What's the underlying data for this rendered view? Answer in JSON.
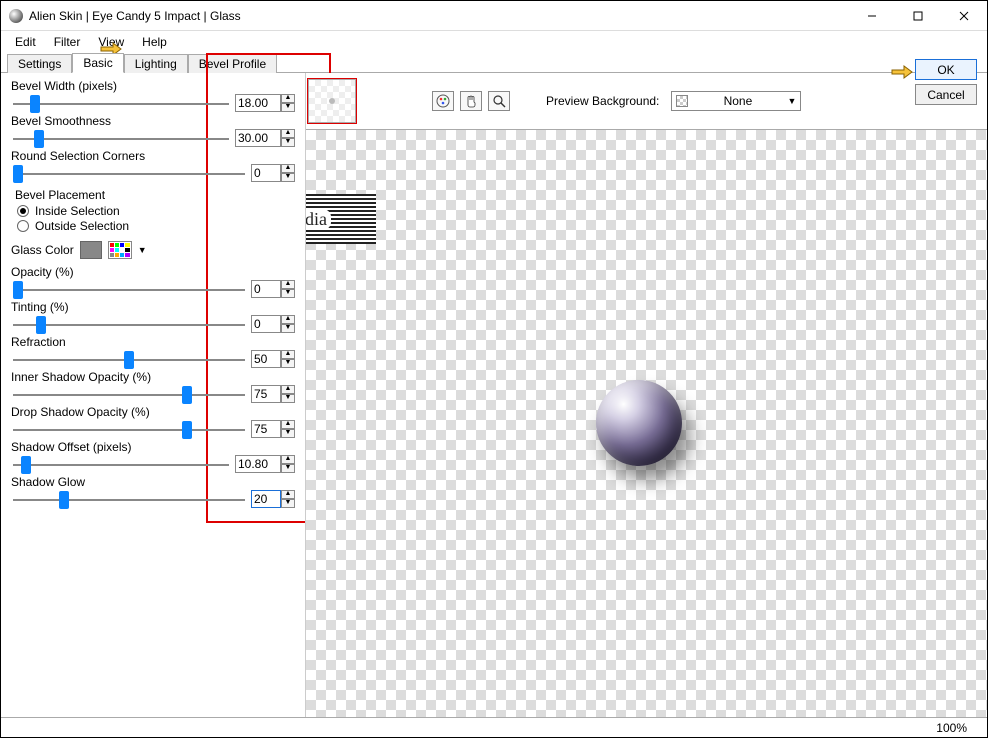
{
  "window": {
    "title": "Alien Skin | Eye Candy 5 Impact | Glass"
  },
  "menus": {
    "edit": "Edit",
    "filter": "Filter",
    "view": "View",
    "help": "Help"
  },
  "tabs": {
    "settings": "Settings",
    "basic": "Basic",
    "lighting": "Lighting",
    "bevel_profile": "Bevel Profile",
    "active": "basic"
  },
  "buttons": {
    "ok": "OK",
    "cancel": "Cancel"
  },
  "preview": {
    "label": "Preview Background:",
    "value": "None"
  },
  "status": {
    "zoom": "100%"
  },
  "params": {
    "bevel_width": {
      "label": "Bevel Width (pixels)",
      "value": "18.00",
      "pos": 10
    },
    "bevel_smoothness": {
      "label": "Bevel Smoothness",
      "value": "30.00",
      "pos": 12
    },
    "round_corners": {
      "label": "Round Selection Corners",
      "value": "0",
      "pos": 2
    },
    "opacity": {
      "label": "Opacity (%)",
      "value": "0",
      "pos": 2
    },
    "tinting": {
      "label": "Tinting (%)",
      "value": "0",
      "pos": 12
    },
    "refraction": {
      "label": "Refraction",
      "value": "50",
      "pos": 50
    },
    "inner_shadow": {
      "label": "Inner Shadow Opacity (%)",
      "value": "75",
      "pos": 75
    },
    "drop_shadow": {
      "label": "Drop Shadow Opacity (%)",
      "value": "75",
      "pos": 75
    },
    "shadow_offset": {
      "label": "Shadow Offset (pixels)",
      "value": "10.80",
      "pos": 6
    },
    "shadow_glow": {
      "label": "Shadow Glow",
      "value": "20",
      "pos": 22
    }
  },
  "bevel_placement": {
    "title": "Bevel Placement",
    "inside": "Inside Selection",
    "outside": "Outside Selection",
    "selected": "inside"
  },
  "glass_color": {
    "label": "Glass Color",
    "hex": "#888888"
  },
  "decor": {
    "label": "claudia"
  }
}
